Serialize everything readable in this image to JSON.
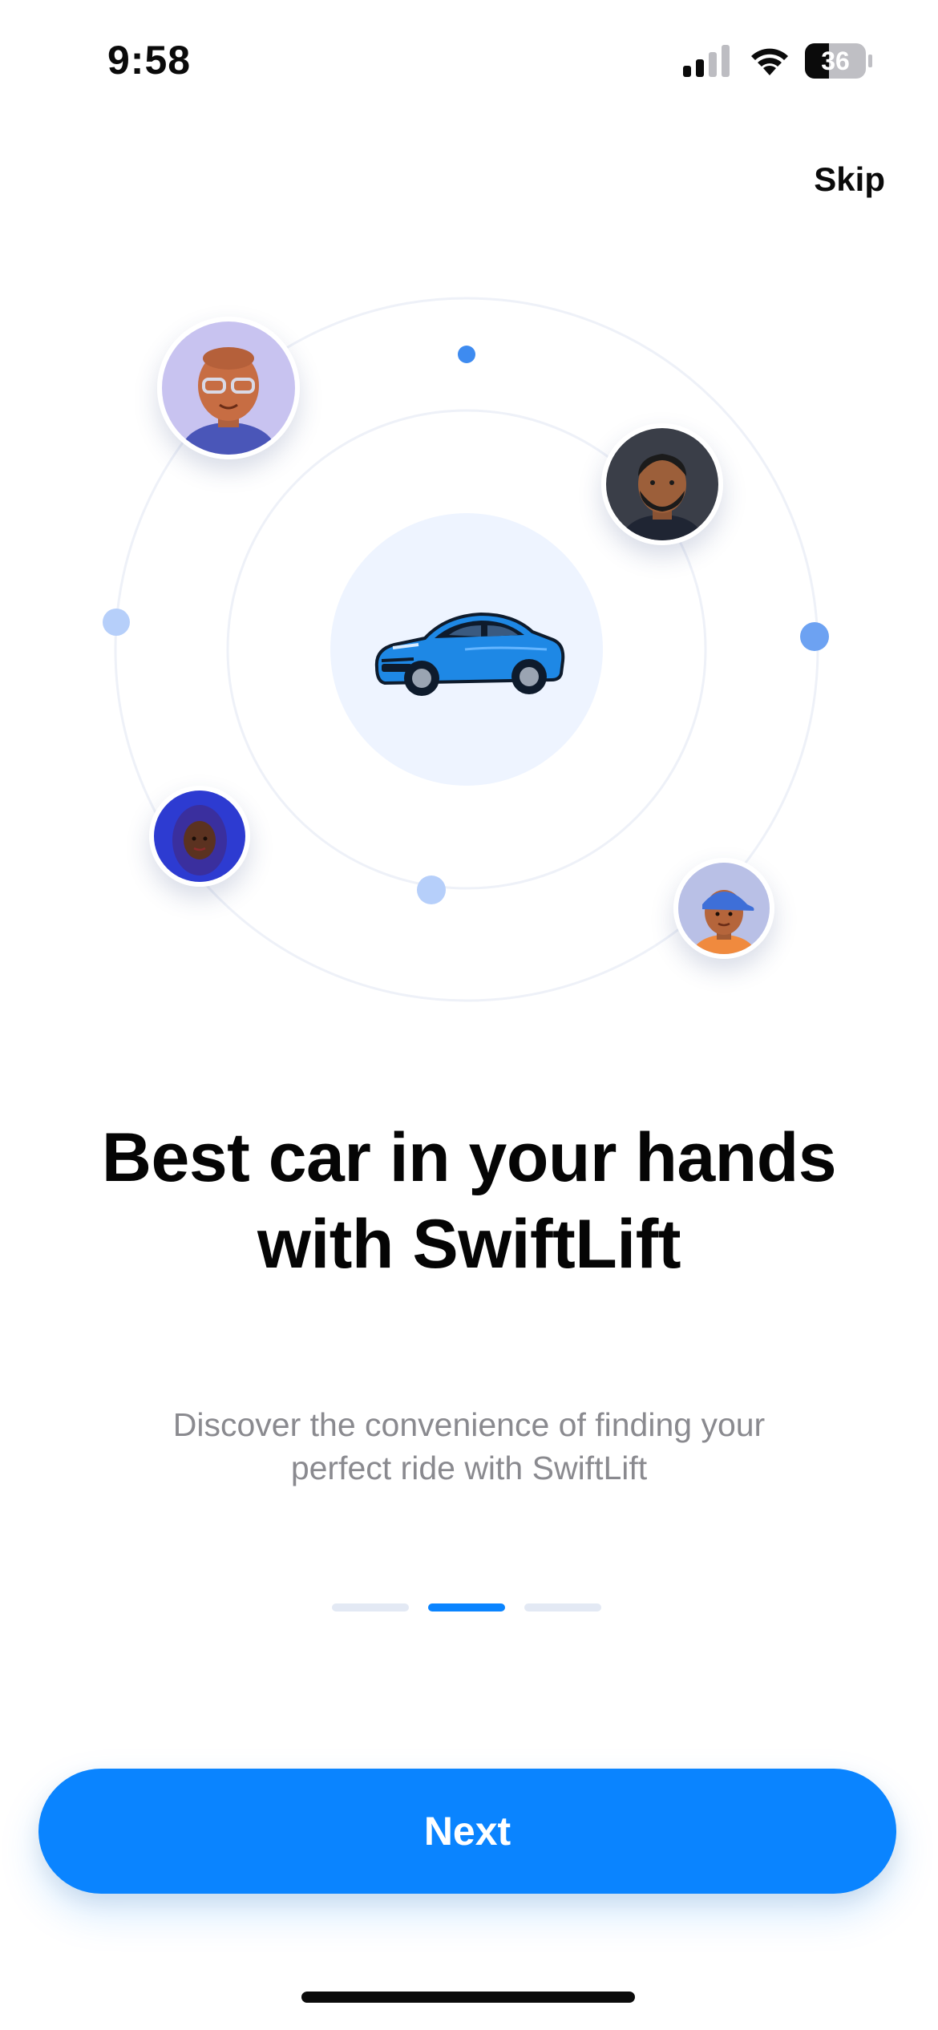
{
  "status_bar": {
    "time": "9:58",
    "battery_level": "36",
    "icons": [
      "signal-icon",
      "wifi-icon",
      "battery-icon"
    ]
  },
  "header": {
    "skip_label": "Skip"
  },
  "illustration": {
    "center_icon": "car-icon",
    "avatars": [
      "avatar-glasses-woman",
      "avatar-bearded-man",
      "avatar-hijab-woman",
      "avatar-cap-boy"
    ],
    "accent_color": "#0a84ff",
    "car_color": "#1e88e5"
  },
  "onboarding": {
    "headline": "Best car in your hands with SwiftLift",
    "subtitle": "Discover the convenience of finding your perfect ride with SwiftLift",
    "page_count": 3,
    "active_page": 2
  },
  "actions": {
    "next_label": "Next"
  },
  "colors": {
    "primary": "#0a84ff",
    "text": "#050505",
    "muted_text": "#8a8a8f",
    "pager_inactive": "#e3e9f4"
  }
}
